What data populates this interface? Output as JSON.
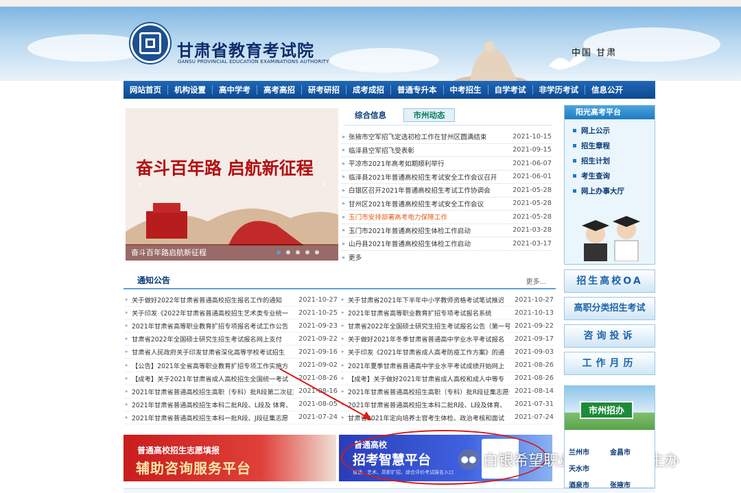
{
  "header": {
    "title": "甘肃省教育考试院",
    "subtitle": "GANSU PROVINCIAL EDUCATION EXAMINATIONS AUTHORITY",
    "region": "中国 甘肃"
  },
  "nav": [
    "网站首页",
    "机构设置",
    "高中学考",
    "高考高招",
    "研考研招",
    "成考成招",
    "普通专升本",
    "中考招生",
    "自学考试",
    "非学历考试",
    "信息公开"
  ],
  "slider": {
    "headline": "奋斗百年路 启航新征程",
    "caption": "奋斗百年路启航新征程",
    "prev": "‹",
    "next": "›"
  },
  "news_tabs": {
    "general": "综合信息",
    "city": "市州动态"
  },
  "news": [
    {
      "title": "张掖市空军招飞定选初检工作在甘州区圆满结束",
      "date": "2021-10-15"
    },
    {
      "title": "临泽县空军招飞受表彰",
      "date": "2021-09-15"
    },
    {
      "title": "平凉市2021年高考如期顺利举行",
      "date": "2021-06-07"
    },
    {
      "title": "临泽县2021年普通高校招生考试安全工作会议召开",
      "date": "2021-06-01"
    },
    {
      "title": "白银区召开2021年普通高校招生考试工作协调会",
      "date": "2021-05-28"
    },
    {
      "title": "甘州区2021年普通高校招生考试安全工作会议",
      "date": "2021-05-28"
    },
    {
      "title": "玉门市安排部署高考电力保障工作",
      "date": "2021-05-28",
      "highlight": true
    },
    {
      "title": "玉门市2021年普通高校招生体检工作启动",
      "date": "2021-03-28"
    },
    {
      "title": "山丹县2021年普通高校招生体检工作启动",
      "date": "2021-03-17"
    },
    {
      "title": "更多",
      "date": ""
    }
  ],
  "notice": {
    "title": "通知公告",
    "more": "更多...",
    "left": [
      {
        "title": "关于做好2022年甘肃省普通高校招生报名工作的通知",
        "date": "2021-10-27"
      },
      {
        "title": "关于印发《2022年甘肃省普通高校招生艺术类专业统一",
        "date": "2021-10-25"
      },
      {
        "title": "2021年甘肃省高等职业教育扩招专项报名考试工作公告",
        "date": "2021-09-23"
      },
      {
        "title": "甘肃省2022年全国硕士研究生招生考试报名网上支付",
        "date": "2021-09-22"
      },
      {
        "title": "甘肃省人民政府关于印发甘肃省深化高等学校考试招生",
        "date": "2021-09-16"
      },
      {
        "title": "【公告】2021年全省高等职业教育扩招专项工作实施方",
        "date": "2021-09-02"
      },
      {
        "title": "【成考】关于2021年甘肃省成人高校招生全国统一考试",
        "date": "2021-08-26"
      },
      {
        "title": "2021年甘肃省普通高校招生高职（专科）批R段第二次征集",
        "date": "2021-08-16"
      },
      {
        "title": "2021年甘肃省普通高校招生本科二批R段、L段及 体育、",
        "date": "2021-08-05"
      },
      {
        "title": "2021年甘肃省普通高校招生本科一批R段、J段征集志愿",
        "date": "2021-07-24"
      }
    ],
    "right": [
      {
        "title": "关于甘肃省2021年下半年中小学教师资格考试笔试推迟",
        "date": "2021-10-27"
      },
      {
        "title": "2021年甘肃省高等职业教育扩招专项考试报名系统",
        "date": "2021-10-13"
      },
      {
        "title": "甘肃省2022年全国硕士研究生招生考试报名公告（第一号",
        "date": "2021-09-22"
      },
      {
        "title": "关于做好2021年冬季甘肃省普通高中学业水平考试报名",
        "date": "2021-09-17"
      },
      {
        "title": "关于印发《2021年甘肃省成人高考防疫工作方案》的通",
        "date": "2021-09-03"
      },
      {
        "title": "2021年夏季甘肃省普通高中学业水平考试成绩开始网上",
        "date": "2021-08-26"
      },
      {
        "title": "【成考】关于做好2021年甘肃省成人高校和成人中等专",
        "date": "2021-08-26"
      },
      {
        "title": "2021年甘肃省普通高校招生高职（专科）批R段征集志愿公",
        "date": "2021-08-14"
      },
      {
        "title": "2021年甘肃省普通高校招生本科二批R段、L段及体育、",
        "date": "2021-07-31"
      },
      {
        "title": "甘肃省2021年定向培养士官考生体检、政治考核和面试",
        "date": "2021-07-24"
      }
    ]
  },
  "promo_left": {
    "line1": "普通高校招生志愿填报",
    "line2": "辅助咨询服务平台"
  },
  "promo_right": {
    "line1": "普通高校",
    "line2": "招考智慧平台",
    "line3": "普通、艺术、高职扩招、综合评价考试报名入口"
  },
  "watermark": "白银希望职业技术学院招生办",
  "sidebar": {
    "header": "阳光高考平台",
    "items": [
      "网上公示",
      "招生章程",
      "招生计划",
      "考生查询",
      "网上办事大厅"
    ],
    "buttons": {
      "oa": "招生高校OA",
      "exam": "高职分类招生考试",
      "consult": "咨询投诉",
      "calendar": "工作月历"
    },
    "city_sign": "市州招办",
    "cities": [
      "兰州市",
      "金昌市",
      "天水市",
      "酒泉市",
      "张掖市"
    ]
  },
  "colors": {
    "nav": "#0c4a93",
    "accent": "#1e7cc2",
    "highlight_news": "#e45f1a",
    "annotation": "#d81b1b"
  }
}
